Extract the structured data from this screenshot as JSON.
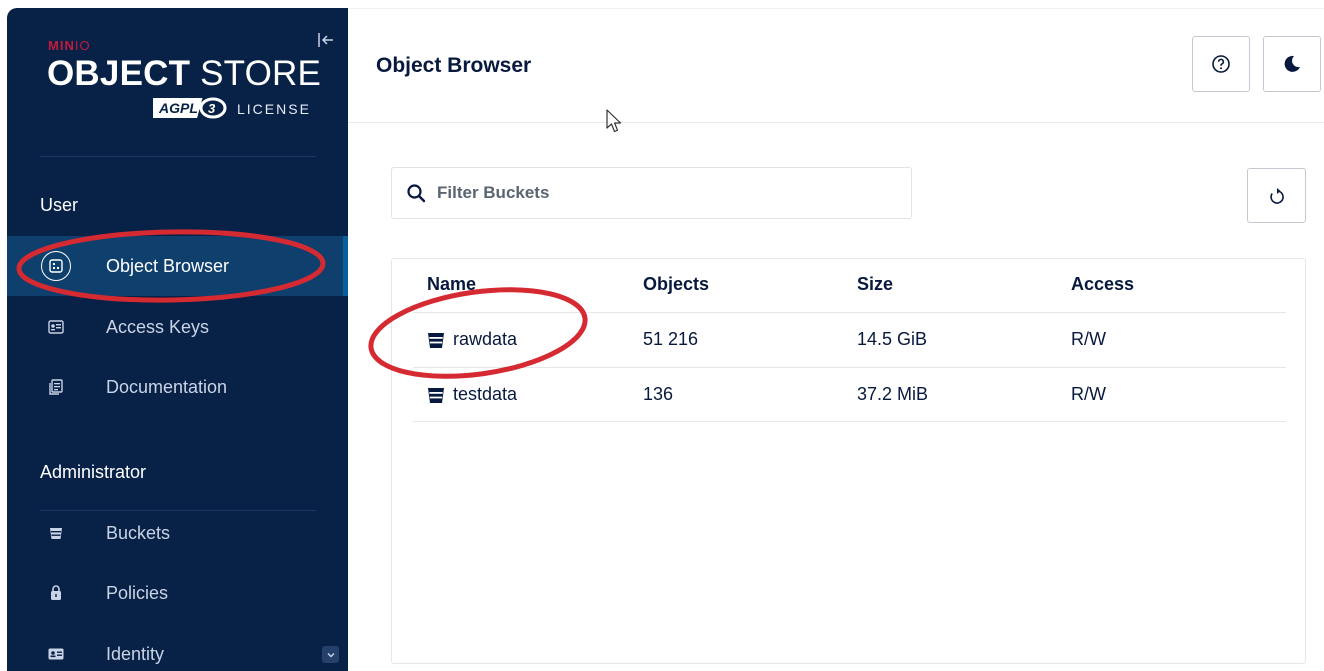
{
  "brand": {
    "minio_bold": "MIN",
    "minio_light": "IO",
    "title_bold": "OBJECT",
    "title_light": " STORE",
    "agpl": "AGPLv3",
    "license": "LICENSE"
  },
  "sidebar": {
    "collapse_icon": "collapse-left-icon",
    "user_section": "User",
    "user_items": [
      {
        "label": "Object Browser",
        "icon": "object-browser-icon",
        "active": true
      },
      {
        "label": "Access Keys",
        "icon": "access-keys-icon",
        "active": false
      },
      {
        "label": "Documentation",
        "icon": "documentation-icon",
        "active": false
      }
    ],
    "admin_section": "Administrator",
    "admin_items": [
      {
        "label": "Buckets",
        "icon": "bucket-icon"
      },
      {
        "label": "Policies",
        "icon": "policy-lock-icon"
      },
      {
        "label": "Identity",
        "icon": "identity-card-icon",
        "expandable": true
      }
    ]
  },
  "header": {
    "title": "Object Browser",
    "help_icon": "help-icon",
    "theme_icon": "dark-mode-moon-icon"
  },
  "filter": {
    "placeholder": "Filter Buckets",
    "value": ""
  },
  "table": {
    "columns": [
      "Name",
      "Objects",
      "Size",
      "Access"
    ],
    "rows": [
      {
        "name": "rawdata",
        "objects": "51 216",
        "size": "14.5 GiB",
        "access": "R/W"
      },
      {
        "name": "testdata",
        "objects": "136",
        "size": "37.2 MiB",
        "access": "R/W"
      }
    ]
  },
  "colors": {
    "sidebar_bg": "#082146",
    "active_item": "#0e3f6d",
    "brand_red": "#c51b3a",
    "annotation_red": "#d62a32"
  }
}
